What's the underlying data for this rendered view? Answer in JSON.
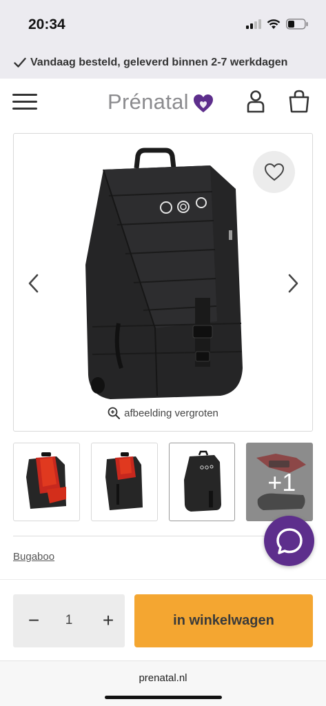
{
  "status": {
    "time": "20:34"
  },
  "promo": {
    "text": "Vandaag besteld, geleverd binnen 2-7 werkdagen",
    "icon": "check-icon"
  },
  "header": {
    "logo": "Prénatal",
    "icons": [
      "menu-icon",
      "account-icon",
      "cart-icon"
    ],
    "brand_color": "#5d2e8c"
  },
  "gallery": {
    "zoom_label": "afbeelding vergroten",
    "more_count": "+1"
  },
  "product": {
    "brand": "Bugaboo"
  },
  "cart": {
    "quantity": "1",
    "minus": "−",
    "plus": "+",
    "add_label": "in winkelwagen",
    "button_color": "#f4a631"
  },
  "browser": {
    "url": "prenatal.nl"
  }
}
